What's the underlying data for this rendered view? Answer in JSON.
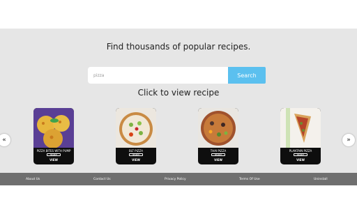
{
  "headline": "Find thousands of popular recipes.",
  "search": {
    "placeholder": "pizza",
    "button_label": "Search"
  },
  "subtitle": "Click to view recipe",
  "carousel": {
    "prev_icon": "«",
    "next_icon": "»",
    "cards": [
      {
        "title": "PIZZA BITES WITH PUMP",
        "button_label": "SEARCH",
        "view_label": "VIEW"
      },
      {
        "title": "BLT PIZZA",
        "button_label": "SEARCH",
        "view_label": "VIEW"
      },
      {
        "title": "THAI PIZZA",
        "button_label": "SEARCH",
        "view_label": "VIEW"
      },
      {
        "title": "PLANTAIN PIZZA",
        "button_label": "SEARCH",
        "view_label": "VIEW"
      }
    ]
  },
  "footer": {
    "links": [
      "About Us",
      "Contact Us",
      "Privacy Policy",
      "Terms Of Use",
      "Uninstall"
    ]
  },
  "colors": {
    "accent": "#5bc0ef",
    "panel": "#e6e6e6",
    "footer": "#6f6f6f",
    "card": "#0e0e0e"
  }
}
